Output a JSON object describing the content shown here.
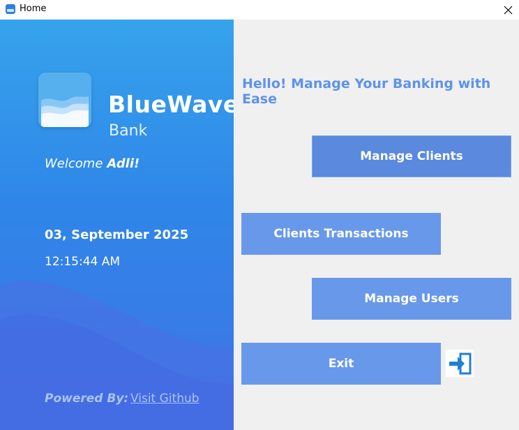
{
  "window": {
    "title": "Home"
  },
  "brand": {
    "name": "BlueWave",
    "sub": "Bank"
  },
  "welcome": {
    "label": "Welcome",
    "user": "Adli!"
  },
  "datetime": {
    "date": "03, September 2025",
    "time": "12:15:44 AM"
  },
  "footer": {
    "powered_by": "Powered By:",
    "github_link": "Visit Github"
  },
  "main": {
    "headline": "Hello! Manage Your Banking with Ease",
    "buttons": {
      "manage_clients": "Manage Clients",
      "clients_transactions": "Clients Transactions",
      "manage_users": "Manage Users",
      "exit": "Exit"
    }
  },
  "colors": {
    "left_panel_top": "#36a3ec",
    "left_panel_bottom": "#3f73e6",
    "button": "#6898ea",
    "button_active": "#5a89dd",
    "headline": "#5e93e9",
    "background": "#f0f0f0"
  },
  "icons": {
    "app": "bank-wave-icon",
    "close": "close-icon",
    "exit": "exit-icon",
    "logo": "wave-logo-icon"
  }
}
